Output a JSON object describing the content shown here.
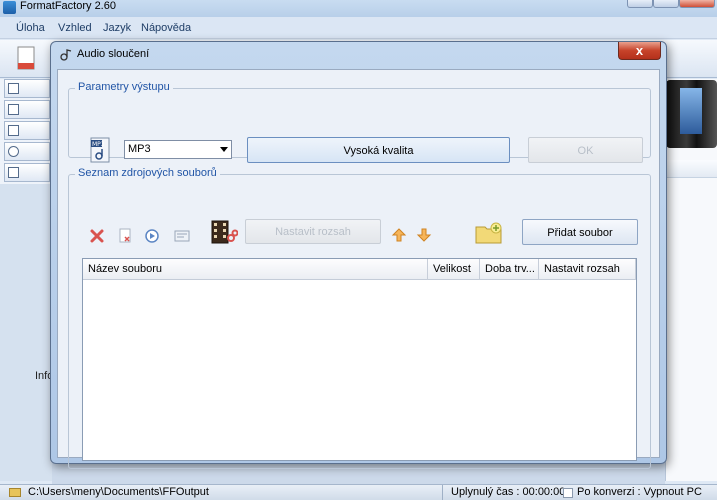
{
  "app": {
    "title": "FormatFactory 2.60",
    "menu": [
      "Úloha",
      "Vzhled",
      "Jazyk",
      "Nápověda"
    ],
    "left_info_text": "Info"
  },
  "dialog": {
    "title": "Audio sloučení",
    "close_label": "x",
    "output_group_label": "Parametry výstupu",
    "format_value": "MP3",
    "format_icon_label": "MP3",
    "quality_button": "Vysoká kvalita",
    "ok_button": "OK",
    "source_group_label": "Seznam zdrojových souborů",
    "set_range_button": "Nastavit rozsah",
    "add_file_button": "Přidat soubor",
    "columns": [
      "Název souboru",
      "Velikost",
      "Doba trv...",
      "Nastavit rozsah"
    ],
    "rows": []
  },
  "status": {
    "output_path": "C:\\Users\\meny\\Documents\\FFOutput",
    "elapsed": "Uplynulý čas : 00:00:00",
    "after_conversion": "Po konverzi : Vypnout PC"
  },
  "colors": {
    "group_label": "#2155a6",
    "close_button": "#c7432a",
    "delete_icon": "#d9534f",
    "arrow_icon": "#f0a030"
  }
}
